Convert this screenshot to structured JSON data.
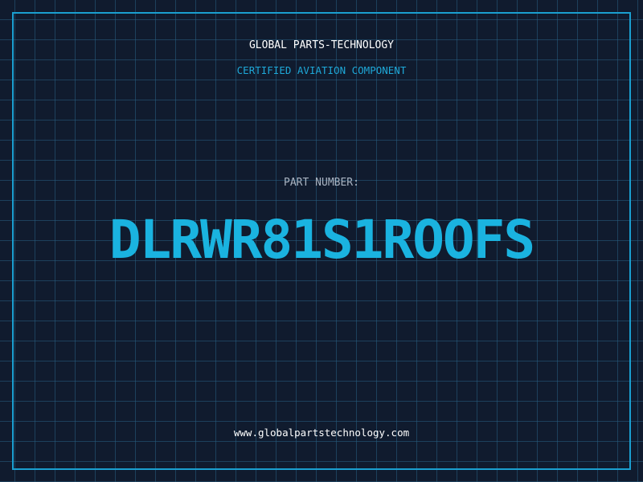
{
  "header": {
    "company": "GLOBAL PARTS-TECHNOLOGY",
    "subtitle": "CERTIFIED AVIATION COMPONENT"
  },
  "part": {
    "label": "PART NUMBER:",
    "number": "DLRWR81S1ROOFS"
  },
  "footer": {
    "website": "www.globalpartstechnology.com"
  },
  "colors": {
    "background": "#101b2e",
    "grid": "#285f82",
    "accent": "#1ab3e0",
    "border": "#1a9fd0"
  }
}
